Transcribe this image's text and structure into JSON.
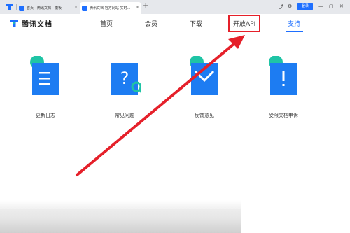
{
  "browser": {
    "tabs": [
      {
        "label": "首页 - 腾讯文档 - 模板",
        "close": "×"
      },
      {
        "label": "腾讯文档-官方网站-实时...",
        "close": "×"
      }
    ],
    "new_tab": "+",
    "login_label": "登录",
    "window_controls": {
      "minimize": "—",
      "maximize": "▢",
      "close": "✕"
    }
  },
  "header": {
    "brand_name": "腾讯文档",
    "nav": [
      "首页",
      "会员",
      "下载",
      "开放API",
      "支持"
    ],
    "active_index": 4,
    "highlighted_index": 3
  },
  "support_cards": [
    {
      "label": "更新日志",
      "icon": "changelog-icon"
    },
    {
      "label": "常见问题",
      "icon": "faq-icon"
    },
    {
      "label": "反馈意见",
      "icon": "feedback-icon"
    },
    {
      "label": "受限文档申诉",
      "icon": "appeal-icon"
    }
  ],
  "colors": {
    "accent": "#1e6fff",
    "icon_blue": "#1d7cf2",
    "icon_teal": "#1fc4a5",
    "annotation_red": "#e5202a"
  }
}
